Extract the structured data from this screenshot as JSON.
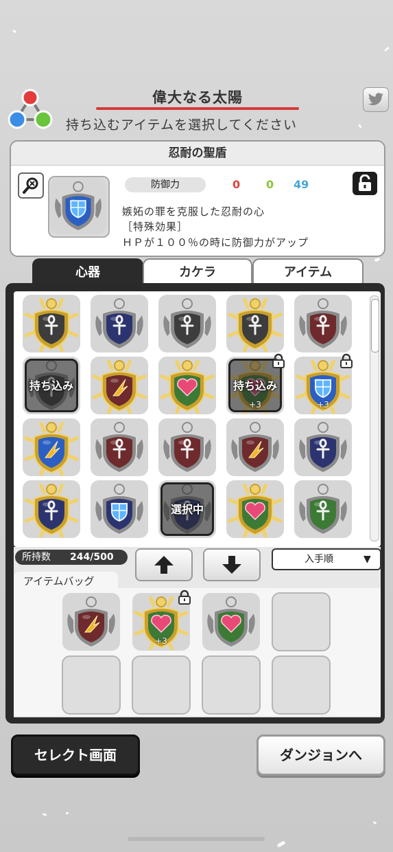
{
  "header": {
    "stage_title": "偉大なる太陽",
    "instruction": "持ち込むアイテムを選択してください"
  },
  "colors": {
    "accent_red": "#d63a3a",
    "stat_red": "#e0443e",
    "stat_green": "#8cc63f",
    "stat_blue": "#44a7d6"
  },
  "detail": {
    "name": "忍耐の聖盾",
    "stat_label": "防御力",
    "stat_values": [
      "0",
      "0",
      "49"
    ],
    "description": [
      "嫉妬の罪を克服した忍耐の心",
      "［特殊効果］",
      "ＨＰが１００％の時に防御力がアップ"
    ],
    "emblem": {
      "frame": "silver",
      "gem": "blue",
      "symbol": "shield"
    }
  },
  "tabs": [
    {
      "label": "心器",
      "active": true
    },
    {
      "label": "カケラ",
      "active": false
    },
    {
      "label": "アイテム",
      "active": false
    }
  ],
  "inventory": {
    "count_label": "所持数",
    "count_value": "244/500",
    "sort_value": "入手順",
    "items": [
      {
        "frame": "gold",
        "gem": "dark",
        "symbol": "ankh"
      },
      {
        "frame": "silver",
        "gem": "navy",
        "symbol": "ankh"
      },
      {
        "frame": "silver",
        "gem": "dark",
        "symbol": "ankh"
      },
      {
        "frame": "gold",
        "gem": "dark",
        "symbol": "ankh"
      },
      {
        "frame": "silver",
        "gem": "red",
        "symbol": "ankh"
      },
      {
        "frame": "silver",
        "gem": "dark",
        "symbol": "ankh",
        "overlay": "持ち込み"
      },
      {
        "frame": "gold",
        "gem": "red",
        "symbol": "wing"
      },
      {
        "frame": "gold",
        "gem": "green",
        "symbol": "heart"
      },
      {
        "frame": "gold",
        "gem": "green",
        "symbol": "heart",
        "overlay": "持ち込み",
        "plus": "+3",
        "locked": true
      },
      {
        "frame": "gold",
        "gem": "blue",
        "symbol": "shield",
        "plus": "+3",
        "locked": true
      },
      {
        "frame": "gold",
        "gem": "blue",
        "symbol": "wing"
      },
      {
        "frame": "silver",
        "gem": "red",
        "symbol": "ankh"
      },
      {
        "frame": "silver",
        "gem": "red",
        "symbol": "ankh"
      },
      {
        "frame": "silver",
        "gem": "red",
        "symbol": "wing"
      },
      {
        "frame": "silver",
        "gem": "navy",
        "symbol": "ankh"
      },
      {
        "frame": "gold",
        "gem": "navy",
        "symbol": "ankh"
      },
      {
        "frame": "silver",
        "gem": "navy",
        "symbol": "shield"
      },
      {
        "frame": "silver",
        "gem": "navy",
        "symbol": "ankh",
        "overlay": "選択中"
      },
      {
        "frame": "gold",
        "gem": "green",
        "symbol": "heart"
      },
      {
        "frame": "silver",
        "gem": "green",
        "symbol": "ankh"
      }
    ]
  },
  "bag": {
    "label": "アイテムバッグ",
    "slots": [
      {
        "frame": "silver",
        "gem": "red",
        "symbol": "wing"
      },
      {
        "frame": "gold",
        "gem": "green",
        "symbol": "heart",
        "plus": "+3",
        "locked": true
      },
      {
        "frame": "silver",
        "gem": "green",
        "symbol": "heart"
      },
      null,
      null,
      null,
      null,
      null
    ]
  },
  "buttons": {
    "select_screen": "セレクト画面",
    "to_dungeon": "ダンジョンへ"
  },
  "icons": [
    "app-logo-icon",
    "twitter-icon",
    "zoom-out-icon",
    "lock-icon",
    "arrow-up-icon",
    "arrow-down-icon",
    "caret-down-icon"
  ]
}
